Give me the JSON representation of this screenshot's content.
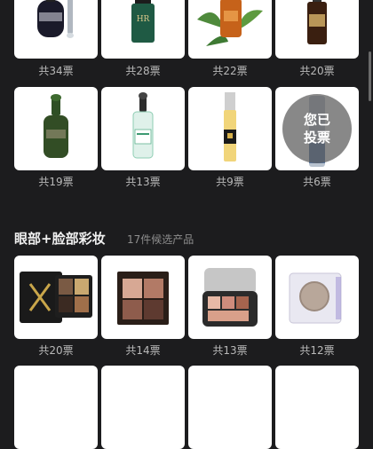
{
  "skincare": {
    "row1": [
      {
        "votes": "共34票",
        "name": "lancome-serum"
      },
      {
        "votes": "共28票",
        "name": "helena-serum"
      },
      {
        "votes": "共22票",
        "name": "amber-serum"
      },
      {
        "votes": "共20票",
        "name": "esteelauder-serum"
      }
    ],
    "row2": [
      {
        "votes": "共19票",
        "name": "lamer-serum"
      },
      {
        "votes": "共13票",
        "name": "skinceuticals-serum"
      },
      {
        "votes": "共9票",
        "name": "ysl-serum"
      },
      {
        "votes": "共6票",
        "name": "clinique-serum",
        "voted_label_1": "您已",
        "voted_label_2": "投票"
      }
    ]
  },
  "makeup_section": {
    "title": "眼部+脸部彩妆",
    "subtitle": "17件候选产品",
    "row": [
      {
        "votes": "共20票",
        "name": "ysl-eyeshadow"
      },
      {
        "votes": "共14票",
        "name": "tomford-eyeshadow"
      },
      {
        "votes": "共13票",
        "name": "chanel-eyeshadow"
      },
      {
        "votes": "共12票",
        "name": "urbandecay-eyeshadow"
      }
    ]
  },
  "colors": {
    "background": "#1c1c1e",
    "card": "#ffffff",
    "vote_text": "#b8b8b8"
  }
}
